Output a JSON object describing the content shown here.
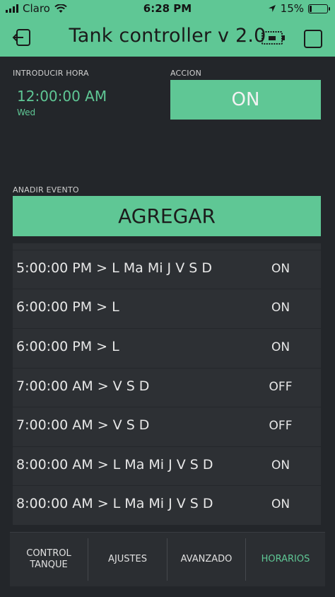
{
  "status": {
    "carrier": "Claro",
    "time": "6:28 PM",
    "battery": "15%",
    "battery_level": 0.15
  },
  "header": {
    "title": "Tank controller v 2.0"
  },
  "time_input": {
    "label": "INTRODUCIR HORA",
    "value": "12:00:00 AM",
    "day": "Wed"
  },
  "action": {
    "label": "ACCION",
    "button": "ON"
  },
  "add_event": {
    "label": "ANADIR EVENTO",
    "button": "AGREGAR"
  },
  "events": [
    {
      "schedule": "5:00:00 PM > L Ma Mi J V S D",
      "action": "ON"
    },
    {
      "schedule": "6:00:00 PM > L",
      "action": "ON"
    },
    {
      "schedule": "6:00:00 PM > L",
      "action": "ON"
    },
    {
      "schedule": "7:00:00 AM > V S D",
      "action": "OFF"
    },
    {
      "schedule": "7:00:00 AM > V S D",
      "action": "OFF"
    },
    {
      "schedule": "8:00:00 AM > L Ma Mi J V S D",
      "action": "ON"
    },
    {
      "schedule": "8:00:00 AM > L Ma Mi J V S D",
      "action": "ON"
    }
  ],
  "tabs": [
    {
      "label": "CONTROL TANQUE",
      "active": false
    },
    {
      "label": "AJUSTES",
      "active": false
    },
    {
      "label": "AVANZADO",
      "active": false
    },
    {
      "label": "HORARIOS",
      "active": true
    }
  ],
  "colors": {
    "accent": "#5fc795",
    "background": "#23262a"
  }
}
